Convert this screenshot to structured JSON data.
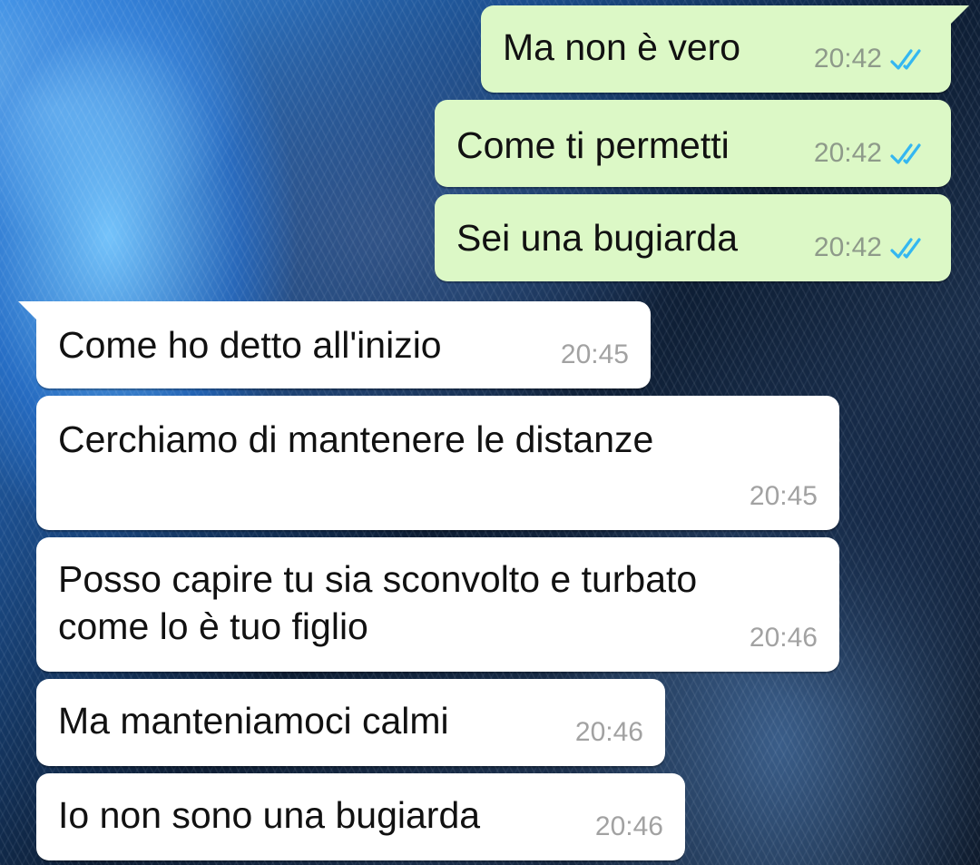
{
  "colors": {
    "outgoing_bubble": "#dcf8c6",
    "incoming_bubble": "#ffffff",
    "read_ticks": "#34b7f1",
    "timestamp": "#a2a2a2"
  },
  "messages": [
    {
      "direction": "outgoing",
      "text": "Ma non è vero",
      "time": "20:42",
      "status_icon": "double-check-read-icon"
    },
    {
      "direction": "outgoing",
      "text": "Come ti permetti",
      "time": "20:42",
      "status_icon": "double-check-read-icon"
    },
    {
      "direction": "outgoing",
      "text": "Sei una bugiarda",
      "time": "20:42",
      "status_icon": "double-check-read-icon"
    },
    {
      "direction": "incoming",
      "text": "Come ho detto all'inizio",
      "time": "20:45"
    },
    {
      "direction": "incoming",
      "text": "Cerchiamo di mantenere le distanze",
      "time": "20:45"
    },
    {
      "direction": "incoming",
      "text_lines": [
        "Posso capire tu sia sconvolto e turbato",
        "come lo è tuo figlio"
      ],
      "time": "20:46"
    },
    {
      "direction": "incoming",
      "text": "Ma manteniamoci calmi",
      "time": "20:46"
    },
    {
      "direction": "incoming",
      "text": "Io non sono una bugiarda",
      "time": "20:46"
    }
  ]
}
